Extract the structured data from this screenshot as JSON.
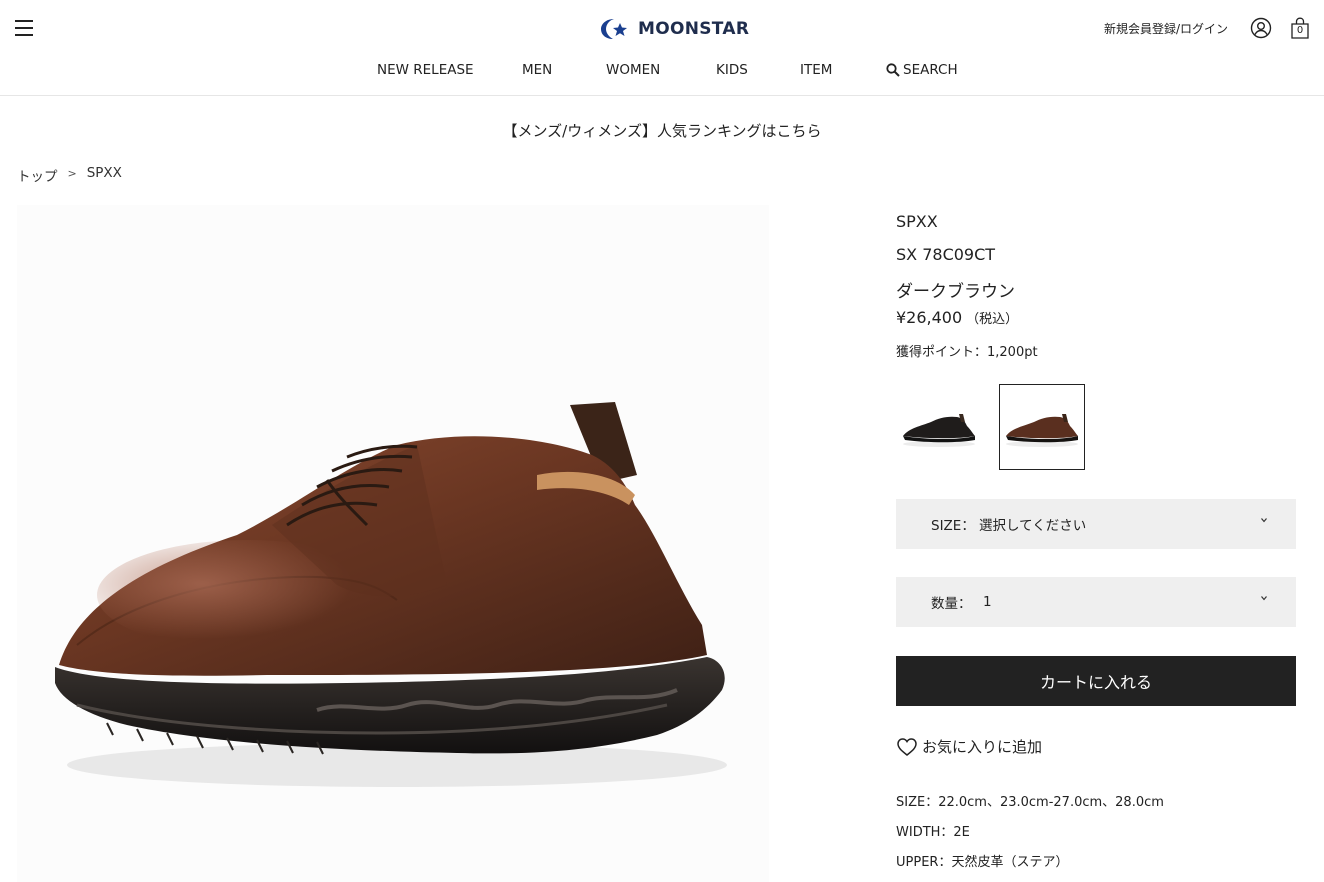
{
  "header": {
    "logo_text": "MOONSTAR",
    "login_label": "新規会員登録/ログイン",
    "cart_count": "0",
    "brand_color": "#1a3f8f"
  },
  "nav": {
    "items": [
      {
        "label": "NEW RELEASE"
      },
      {
        "label": "MEN"
      },
      {
        "label": "WOMEN"
      },
      {
        "label": "KIDS"
      },
      {
        "label": "ITEM"
      },
      {
        "label": "SEARCH",
        "icon": "search-icon"
      }
    ]
  },
  "banner": {
    "text": "【メンズ/ウィメンズ】人気ランキングはこちら"
  },
  "breadcrumb": {
    "items": [
      "トップ",
      "SPXX"
    ],
    "separator": ">"
  },
  "product": {
    "brand": "SPXX",
    "model": "SX 78C09CT",
    "color": "ダークブラウン",
    "price": "¥26,400",
    "tax_note": "（税込）",
    "points": "獲得ポイント：1,200pt",
    "thumbnails": [
      {
        "name": "black",
        "color": "#1c1a19",
        "selected": false
      },
      {
        "name": "dark-brown",
        "color": "#4d2a1c",
        "selected": true
      }
    ]
  },
  "options": {
    "size_label": "SIZE：",
    "size_value": "選択してください",
    "qty_label": "数量：",
    "qty_value": "1"
  },
  "actions": {
    "cart_label": "カートに入れる",
    "favorite_label": "お気に入りに追加"
  },
  "specs": {
    "size": "SIZE：22.0cm、23.0cm-27.0cm、28.0cm",
    "width": "WIDTH：2E",
    "upper": "UPPER：天然皮革（ステア）"
  }
}
